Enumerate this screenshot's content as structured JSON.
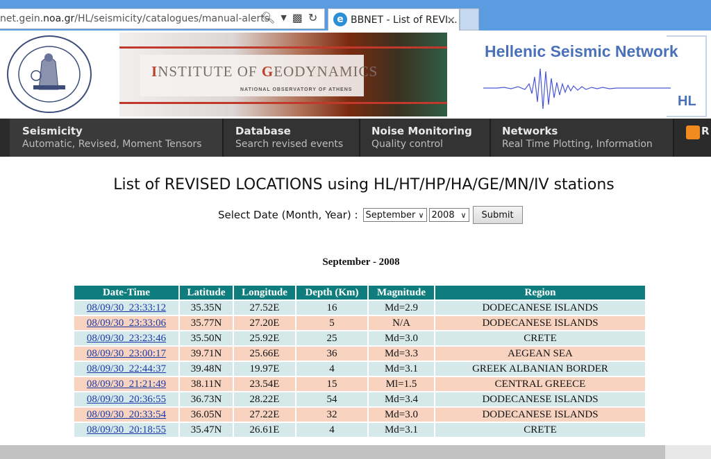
{
  "browser": {
    "address_prefix": "net.gein.",
    "address_domain": "noa.gr",
    "address_path": "/HL/seismicity/catalogues/manual-alerts",
    "tab_title": "BBNET - List of REVI...",
    "tab_close": "×"
  },
  "header": {
    "banner_title_parts": [
      "I",
      "NSTITUTE OF ",
      "G",
      "EODYNAMICS"
    ],
    "banner_subtitle": "NATIONAL OBSERVATORY OF ATHENS",
    "network_title": "Hellenic Seismic Network",
    "network_code": "HL"
  },
  "nav": {
    "items": [
      {
        "title": "Seismicity",
        "subtitle": "Automatic, Revised, Moment Tensors"
      },
      {
        "title": "Database",
        "subtitle": "Search revised events"
      },
      {
        "title": "Noise Monitoring",
        "subtitle": "Quality control"
      },
      {
        "title": "Networks",
        "subtitle": "Real Time Plotting, Information"
      }
    ],
    "rss_letter": "R"
  },
  "page": {
    "title": "List of REVISED LOCATIONS using HL/HT/HP/HA/GE/MN/IV stations",
    "form_label": "Select Date (Month, Year) :",
    "month_value": "September",
    "year_value": "2008",
    "submit_label": "Submit",
    "month_heading": "September - 2008"
  },
  "table": {
    "headers": [
      "Date-Time",
      "Latitude",
      "Longitude",
      "Depth (Km)",
      "Magnitude",
      "Region"
    ],
    "rows": [
      [
        "08/09/30_23:33:12",
        "35.35N",
        "27.52E",
        "16",
        "Md=2.9",
        "DODECANESE ISLANDS"
      ],
      [
        "08/09/30_23:33:06",
        "35.77N",
        "27.20E",
        "5",
        "N/A",
        "DODECANESE ISLANDS"
      ],
      [
        "08/09/30_23:23:46",
        "35.50N",
        "25.92E",
        "25",
        "Md=3.0",
        "CRETE"
      ],
      [
        "08/09/30_23:00:17",
        "39.71N",
        "25.66E",
        "36",
        "Md=3.3",
        "AEGEAN SEA"
      ],
      [
        "08/09/30_22:44:37",
        "39.48N",
        "19.97E",
        "4",
        "Md=3.1",
        "GREEK ALBANIAN BORDER"
      ],
      [
        "08/09/30_21:21:49",
        "38.11N",
        "23.54E",
        "15",
        "Ml=1.5",
        "CENTRAL GREECE"
      ],
      [
        "08/09/30_20:36:55",
        "36.73N",
        "28.22E",
        "54",
        "Md=3.4",
        "DODECANESE ISLANDS"
      ],
      [
        "08/09/30_20:33:54",
        "36.05N",
        "27.22E",
        "32",
        "Md=3.0",
        "DODECANESE ISLANDS"
      ],
      [
        "08/09/30_20:18:55",
        "35.47N",
        "26.61E",
        "4",
        "Md=3.1",
        "CRETE"
      ]
    ]
  },
  "colors": {
    "header_teal": "#0f7d7d",
    "row_even": "#d5e9eb",
    "row_odd": "#f8d3bf",
    "nav_bg": "#333333",
    "browser_blue": "#5b9be0"
  }
}
